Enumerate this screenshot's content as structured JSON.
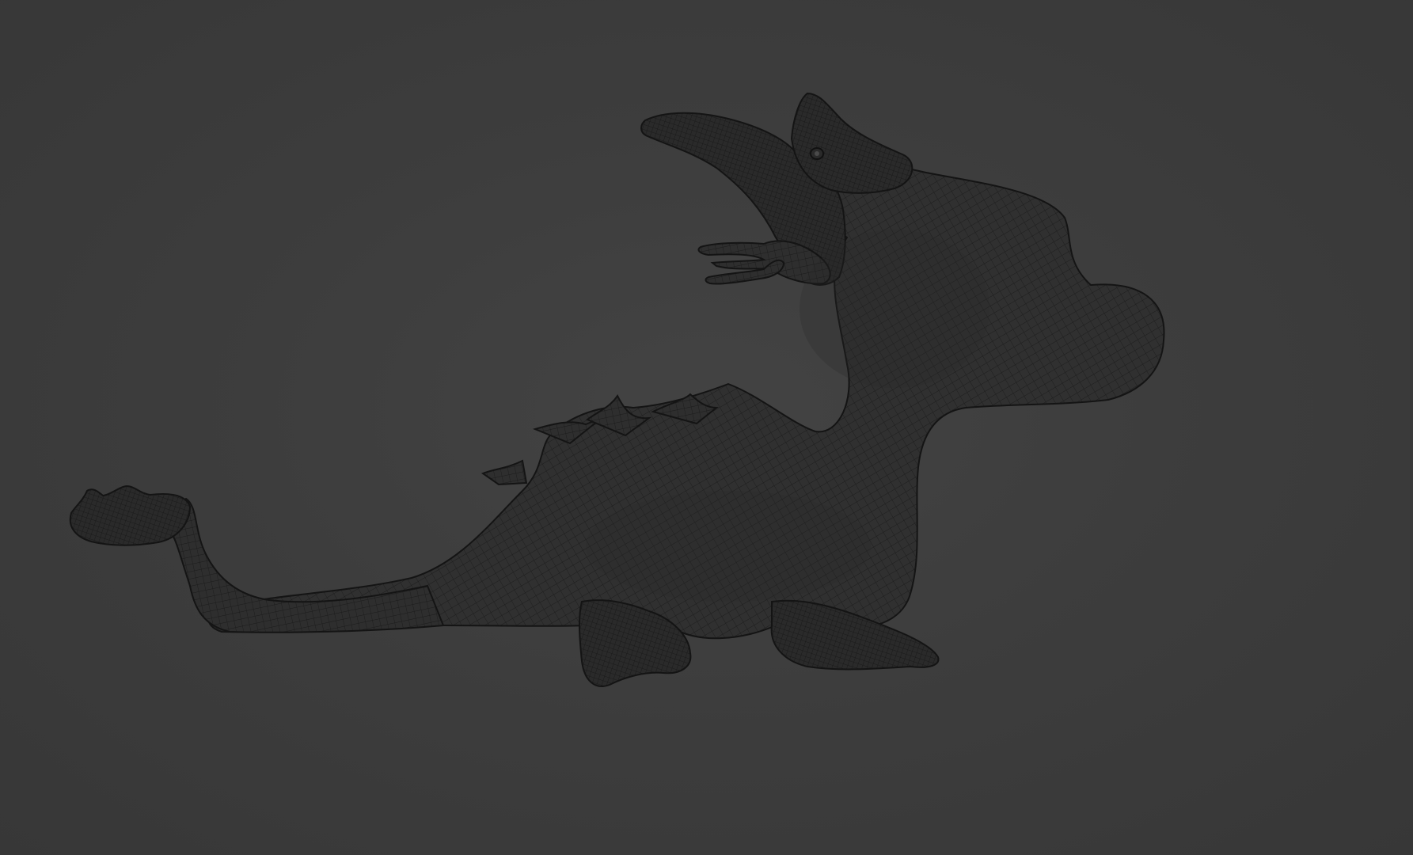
{
  "viewport": {
    "background_color": "#3d3d3d",
    "display_mode": "wireframe"
  },
  "model": {
    "object": "dragon-mesh",
    "silhouette_color": "#2b2b2b",
    "wire_color": "#1c1c1c",
    "edge_color": "#141414"
  }
}
